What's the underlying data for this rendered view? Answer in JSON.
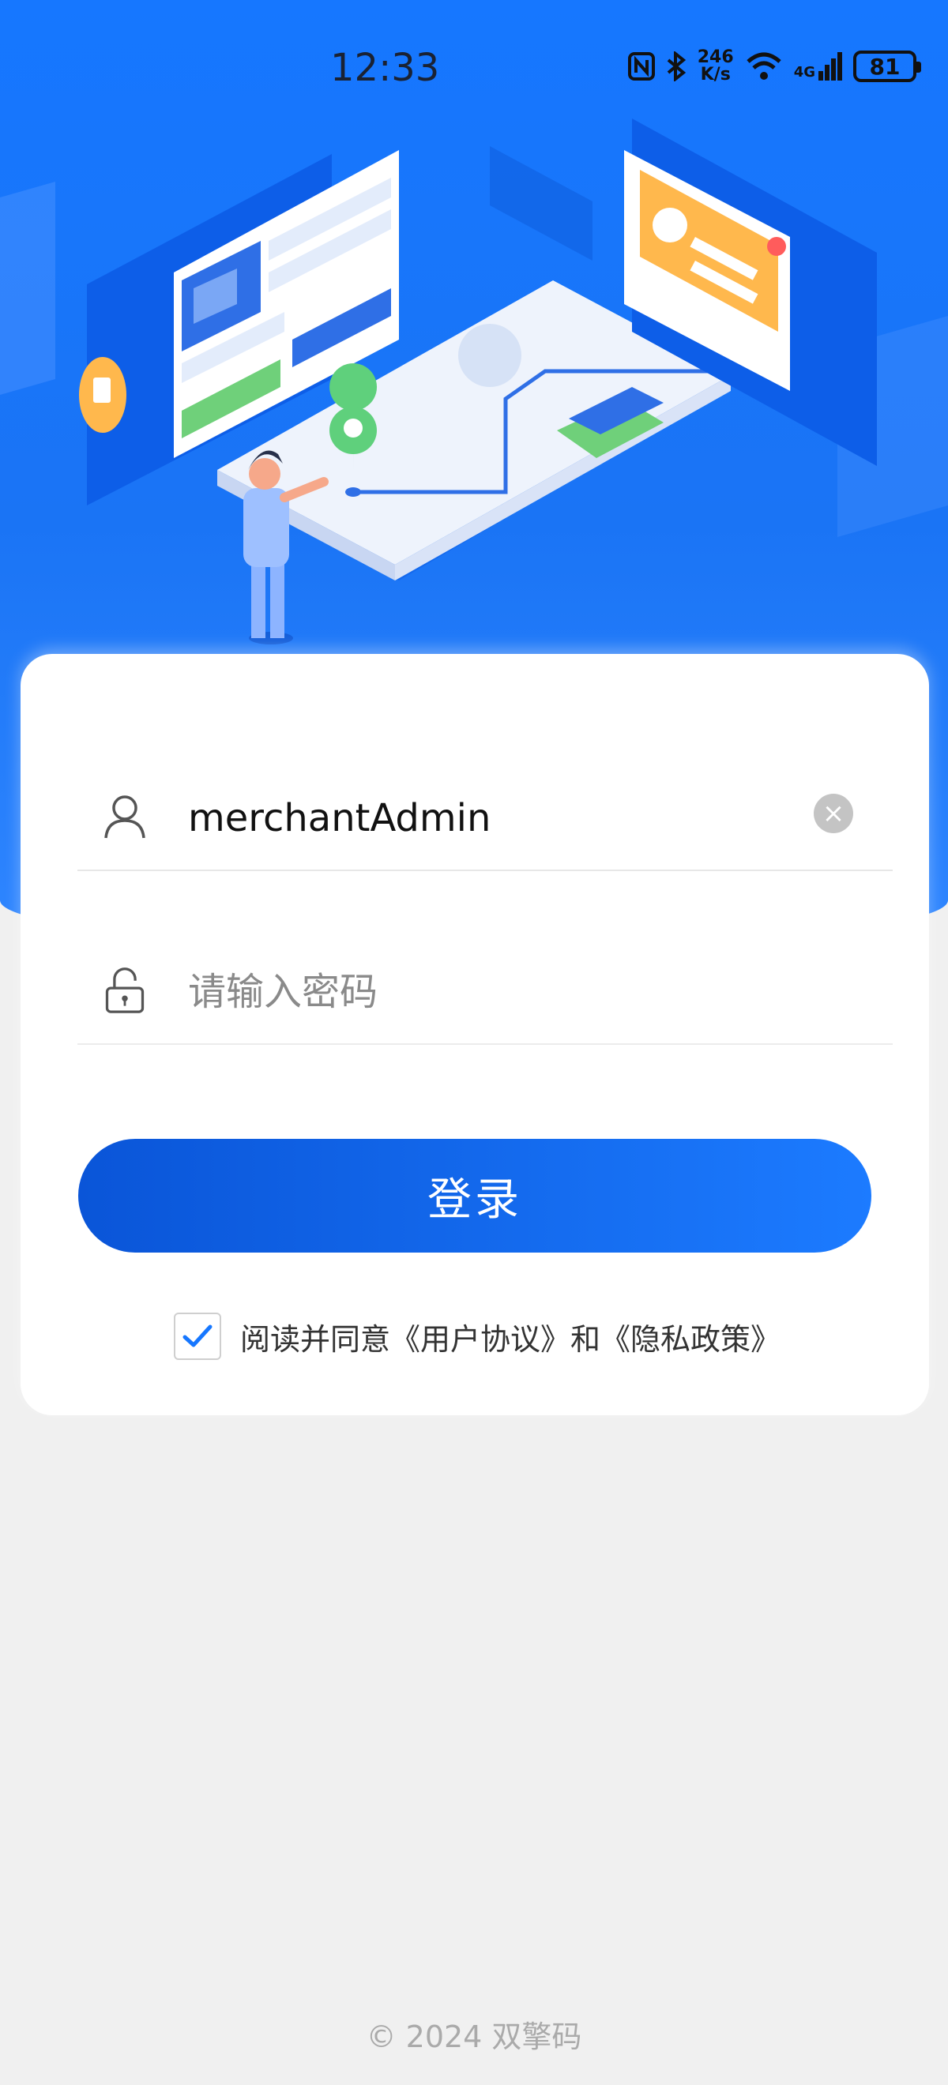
{
  "status_bar": {
    "time": "12:33",
    "net_speed_value": "246",
    "net_speed_unit": "K/s",
    "network": "4G",
    "battery": "81",
    "icons": [
      "nfc-icon",
      "bluetooth-icon",
      "wifi-icon",
      "signal-icon",
      "battery-icon"
    ]
  },
  "login_form": {
    "username_value": "merchantAdmin",
    "password_placeholder": "请输入密码",
    "login_button": "登录",
    "agree_prefix": "阅读并同意",
    "user_agreement": "《用户协议》",
    "and": "和",
    "privacy_policy": "《隐私政策》",
    "agree_checked": true
  },
  "footer": {
    "copyright": "© 2024 双擎码"
  },
  "colors": {
    "primary": "#1677ff",
    "button_start": "#0a55d8",
    "button_end": "#1c7bff",
    "background": "#f0f0f0"
  }
}
